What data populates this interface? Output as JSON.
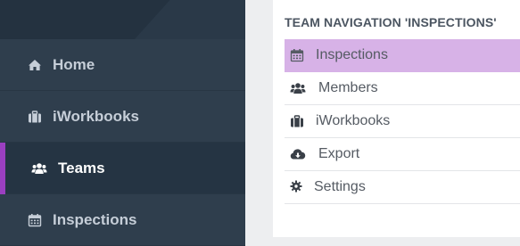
{
  "sidebar": {
    "items": [
      {
        "label": "Home",
        "icon": "home-icon",
        "active": false
      },
      {
        "label": "iWorkbooks",
        "icon": "briefcase-icon",
        "active": false
      },
      {
        "label": "Teams",
        "icon": "users-icon",
        "active": true
      },
      {
        "label": "Inspections",
        "icon": "calendar-icon",
        "active": false
      }
    ],
    "accent_color": "#9b3fc0"
  },
  "panel": {
    "title": "TEAM NAVIGATION 'INSPECTIONS'",
    "items": [
      {
        "label": "Inspections",
        "icon": "calendar-icon",
        "active": true
      },
      {
        "label": "Members",
        "icon": "users-icon",
        "active": false
      },
      {
        "label": "iWorkbooks",
        "icon": "briefcase-icon",
        "active": false
      },
      {
        "label": "Export",
        "icon": "cloud-download-icon",
        "active": false
      },
      {
        "label": "Settings",
        "icon": "gear-icon",
        "active": false
      }
    ],
    "active_color": "#d7b2e7"
  }
}
